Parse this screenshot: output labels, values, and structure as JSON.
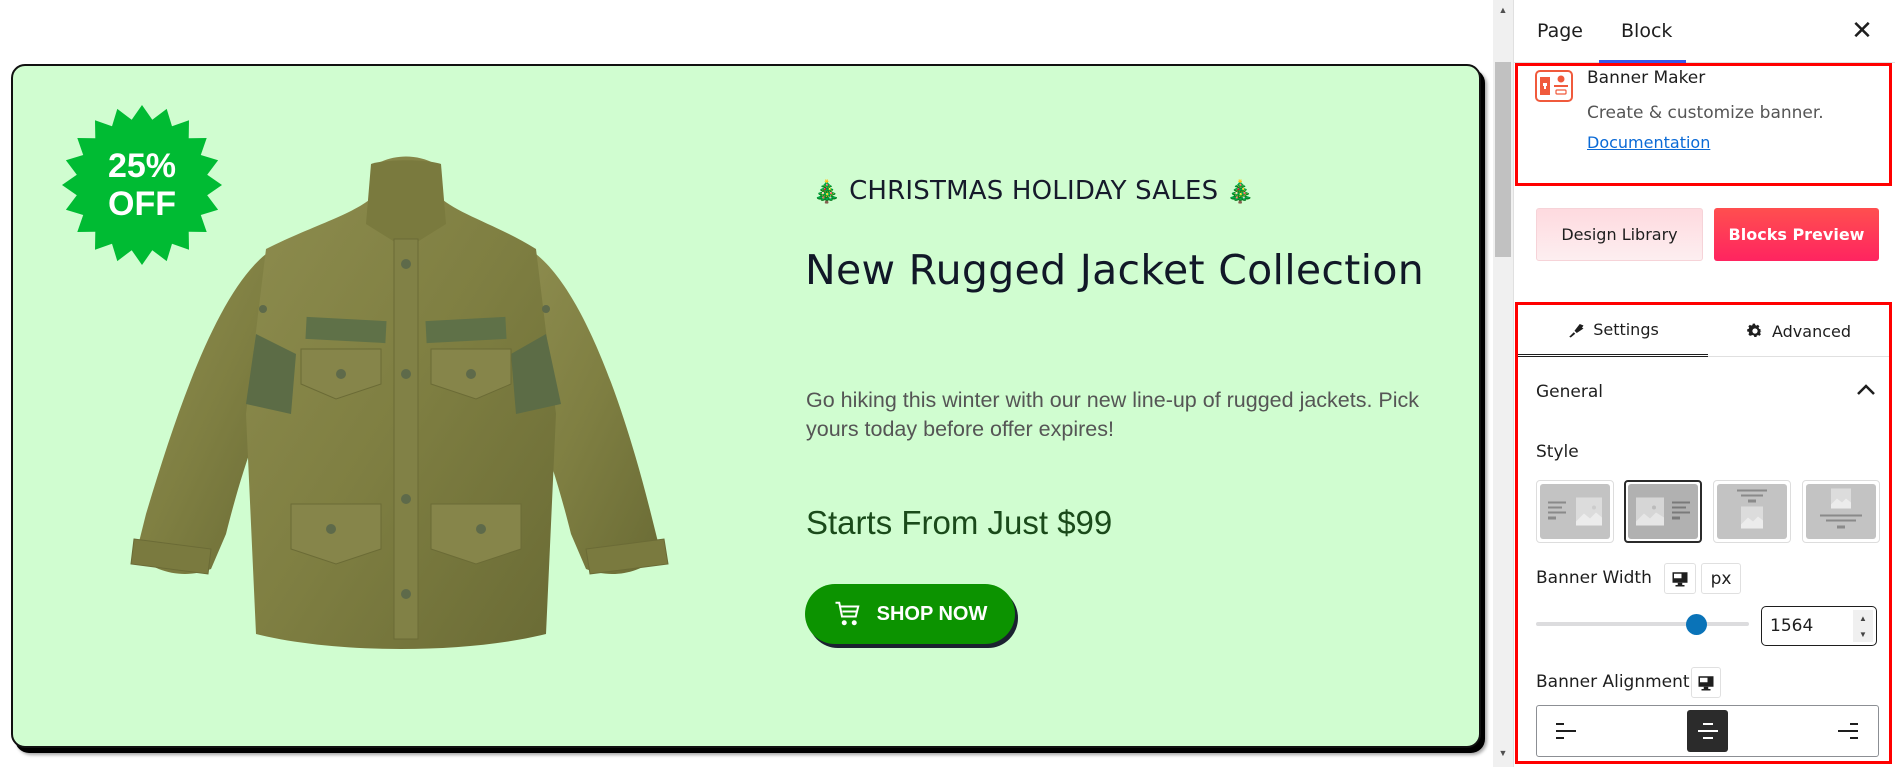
{
  "banner": {
    "badge": {
      "line1": "25%",
      "line2": "OFF",
      "color": "#00bb33"
    },
    "eyebrow": "CHRISTMAS HOLIDAY SALES",
    "eyebrow_icon": "🎄",
    "title": "New Rugged Jacket Collection",
    "description": "Go hiking this winter with our new line-up of rugged jackets. Pick yours today before offer expires!",
    "price": "Starts From Just $99",
    "cta_label": "SHOP NOW",
    "cta_icon": "cart-icon",
    "background": "#d0fdd0",
    "image": "jacket-image",
    "add_block_label": "+"
  },
  "sidebar": {
    "tabs": [
      {
        "label": "Page",
        "active": false
      },
      {
        "label": "Block",
        "active": true
      }
    ],
    "close_label": "✕",
    "block": {
      "name": "Banner Maker",
      "description": "Create & customize banner.",
      "doc_link": "Documentation",
      "icon": "banner-maker-icon"
    },
    "buttons": {
      "design_library": "Design Library",
      "blocks_preview": "Blocks Preview"
    },
    "panel_tabs": [
      {
        "label": "Settings",
        "icon": "brush-icon",
        "active": true
      },
      {
        "label": "Advanced",
        "icon": "gear-icon",
        "active": false
      }
    ],
    "section": {
      "title": "General",
      "expanded": true
    },
    "style": {
      "label": "Style",
      "options": [
        "content-left-image-right",
        "image-left-content-right",
        "content-top-image-bottom",
        "image-top-content-bottom"
      ],
      "selected_index": 1
    },
    "banner_width": {
      "label": "Banner Width",
      "device_icon": "desktop-icon",
      "unit": "px",
      "value": "1564",
      "slider_fraction": 0.75
    },
    "banner_alignment": {
      "label": "Banner Alignment",
      "device_icon": "desktop-icon",
      "options": [
        "align-left",
        "align-center",
        "align-right"
      ],
      "selected": "align-center"
    },
    "highlight_color": "#ff0000"
  }
}
